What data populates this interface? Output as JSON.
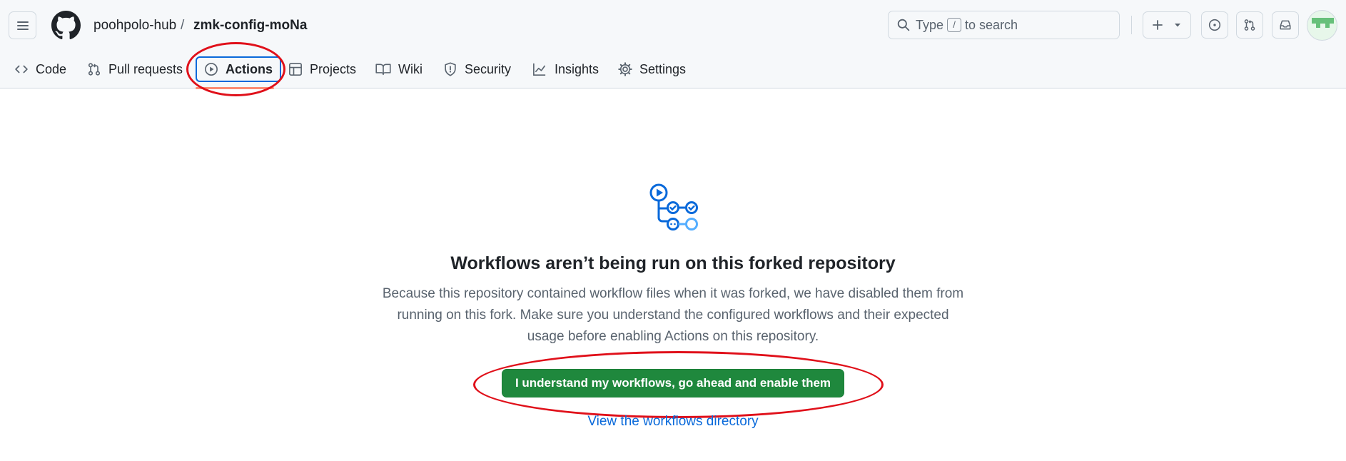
{
  "breadcrumb": {
    "owner": "poohpolo-hub",
    "separator": "/",
    "repo": "zmk-config-moNa"
  },
  "search": {
    "prefix": "Type",
    "shortcut": "/",
    "suffix": "to search"
  },
  "tabs": [
    {
      "label": "Code",
      "icon": "code-icon"
    },
    {
      "label": "Pull requests",
      "icon": "git-pull-request-icon"
    },
    {
      "label": "Actions",
      "icon": "play-icon"
    },
    {
      "label": "Projects",
      "icon": "table-icon"
    },
    {
      "label": "Wiki",
      "icon": "book-icon"
    },
    {
      "label": "Security",
      "icon": "shield-icon"
    },
    {
      "label": "Insights",
      "icon": "graph-icon"
    },
    {
      "label": "Settings",
      "icon": "gear-icon"
    }
  ],
  "main": {
    "title": "Workflows aren’t being run on this forked repository",
    "description_lines": [
      "Because this repository contained workflow files when it was forked, we have disabled them from",
      "running on this fork. Make sure you understand the configured workflows and their expected",
      "usage before enabling Actions on this repository."
    ],
    "enable_button": "I understand my workflows, go ahead and enable them",
    "directory_link": "View the workflows directory"
  },
  "colors": {
    "accent": "#0969da",
    "primary_button": "#1f883d",
    "annotation": "#e0101a"
  }
}
